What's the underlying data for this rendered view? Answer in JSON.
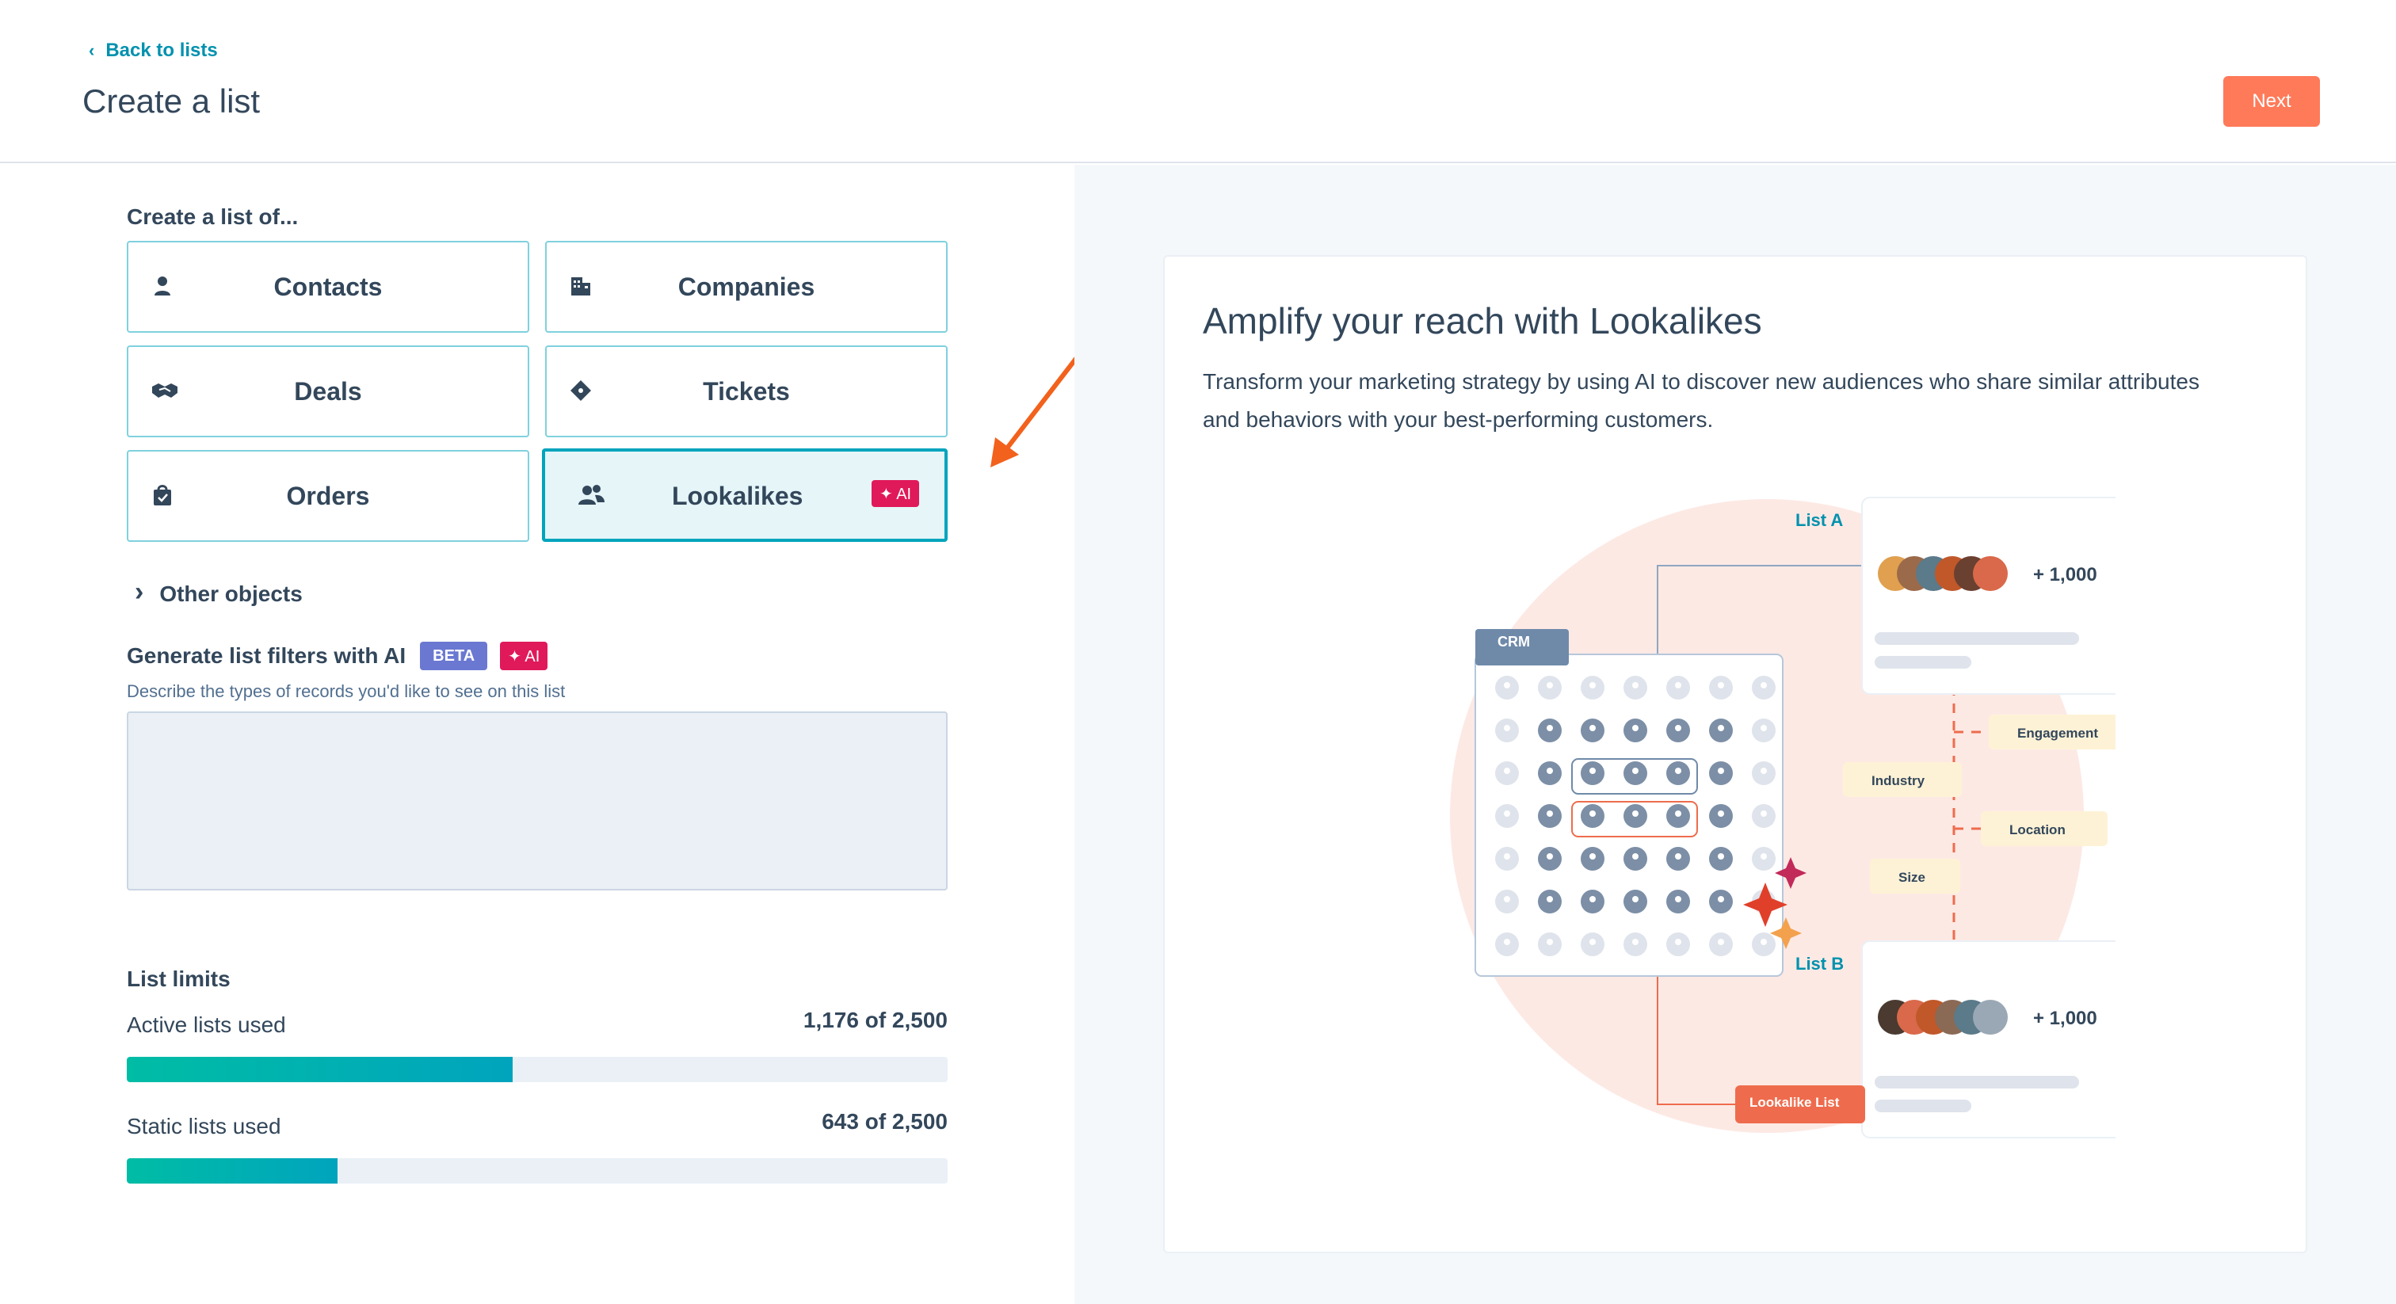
{
  "header": {
    "back_label": "Back to lists",
    "title": "Create a list",
    "next_label": "Next"
  },
  "create_section": {
    "label": "Create a list of...",
    "objects": [
      {
        "label": "Contacts",
        "icon": "contact-icon"
      },
      {
        "label": "Companies",
        "icon": "building-icon"
      },
      {
        "label": "Deals",
        "icon": "handshake-icon"
      },
      {
        "label": "Tickets",
        "icon": "ticket-icon"
      },
      {
        "label": "Orders",
        "icon": "shopping-bag-icon"
      },
      {
        "label": "Lookalikes",
        "icon": "users-icon",
        "badge": "✦ AI",
        "selected": true
      }
    ],
    "other_objects_label": "Other objects"
  },
  "ai_filters": {
    "title": "Generate list filters with AI",
    "beta_badge": "BETA",
    "ai_badge": "✦ AI",
    "description": "Describe the types of records you'd like to see on this list",
    "textarea_value": ""
  },
  "limits": {
    "title": "List limits",
    "active": {
      "label": "Active lists used",
      "value_text": "1,176 of 2,500",
      "used": 1176,
      "total": 2500
    },
    "static": {
      "label": "Static lists used",
      "value_text": "643 of 2,500",
      "used": 643,
      "total": 2500
    }
  },
  "promo": {
    "title": "Amplify your reach with Lookalikes",
    "body": "Transform your marketing strategy by using AI to discover new audiences who share similar attributes and behaviors with your best-performing customers.",
    "illustration": {
      "crm_label": "CRM",
      "list_a_label": "List A",
      "list_a_count": "+ 1,000",
      "list_b_label": "List B",
      "list_b_count": "+ 1,000",
      "lookalike_label": "Lookalike List",
      "attributes": [
        "Engagement",
        "Industry",
        "Location",
        "Size"
      ]
    }
  },
  "colors": {
    "accent": "#ff7a59",
    "teal": "#00a4bd",
    "ai_pink": "#e0195a",
    "beta_purple": "#6a78d1",
    "arrow_orange": "#f2621d"
  }
}
